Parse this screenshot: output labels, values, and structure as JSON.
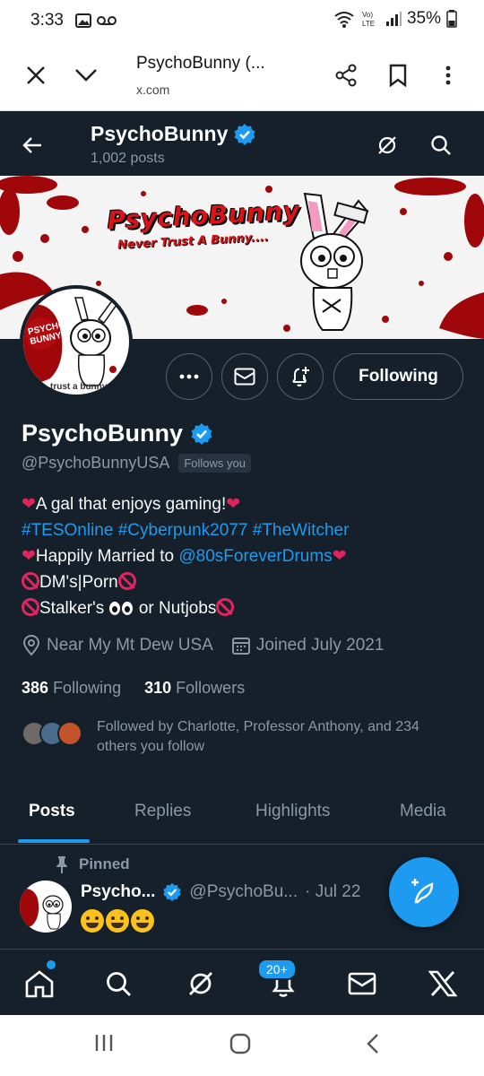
{
  "status_bar": {
    "time": "3:33",
    "battery": "35%"
  },
  "browser": {
    "title": "PsychoBunny (...",
    "domain": "x.com"
  },
  "header": {
    "name": "PsychoBunny",
    "posts_count": "1,002 posts"
  },
  "banner": {
    "logo_main": "PsychoBunny",
    "logo_sub": "Never Trust A Bunny...."
  },
  "avatar": {
    "text_top": "PSYCHO BUNNY",
    "text_bottom": "trust a bunny"
  },
  "actions": {
    "following_label": "Following"
  },
  "profile": {
    "name": "PsychoBunny",
    "handle": "@PsychoBunnyUSA",
    "follows_you": "Follows you",
    "bio": {
      "line1": "A gal that enjoys gaming!",
      "hashtags": "#TESOnline #Cyberpunk2077 #TheWitcher",
      "line3_pre": "Happily Married to ",
      "line3_link": "@80sForeverDrums",
      "line4": "DM's|Porn",
      "line5_a": "Stalker's ",
      "line5_b": " or Nutjobs"
    },
    "location": "Near My Mt Dew USA",
    "joined": "Joined July 2021",
    "following_count": "386",
    "following_label": "Following",
    "followers_count": "310",
    "followers_label": "Followers",
    "followed_by": "Followed by Charlotte, Professor Anthony, and 234 others you follow"
  },
  "tabs": [
    {
      "label": "Posts"
    },
    {
      "label": "Replies"
    },
    {
      "label": "Highlights"
    },
    {
      "label": "Media"
    }
  ],
  "post": {
    "pinned_label": "Pinned",
    "name": "Psycho...",
    "handle": "@PsychoBu...",
    "date": "· Jul 22"
  },
  "bottom_nav": {
    "notif_badge": "20+"
  },
  "colors": {
    "background": "#15202b",
    "accent": "#1d9bf0",
    "muted": "#8b98a5",
    "heart": "#e0245e"
  }
}
